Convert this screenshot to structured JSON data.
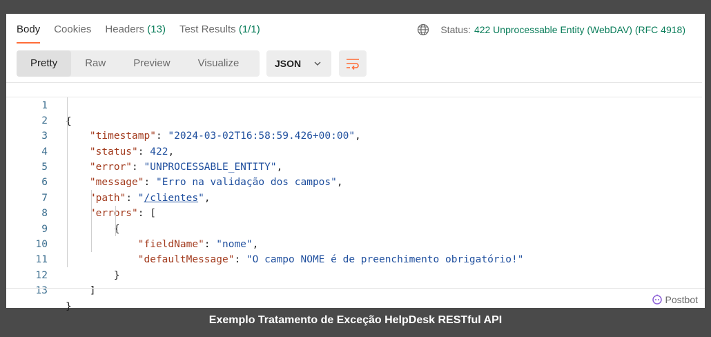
{
  "tabs": [
    {
      "label": "Body",
      "count": ""
    },
    {
      "label": "Cookies",
      "count": ""
    },
    {
      "label": "Headers",
      "count": "(13)"
    },
    {
      "label": "Test Results",
      "count": "(1/1)"
    }
  ],
  "status": {
    "label": "Status:",
    "value": "422 Unprocessable Entity (WebDAV) (RFC 4918)",
    "icon": "globe-icon"
  },
  "view_modes": [
    "Pretty",
    "Raw",
    "Preview",
    "Visualize"
  ],
  "format": {
    "selected": "JSON",
    "icon": "chevron-down-icon"
  },
  "wrap_icon": "wrap-lines-icon",
  "code_lines": [
    {
      "n": "1"
    },
    {
      "n": "2"
    },
    {
      "n": "3"
    },
    {
      "n": "4"
    },
    {
      "n": "5"
    },
    {
      "n": "6"
    },
    {
      "n": "7"
    },
    {
      "n": "8"
    },
    {
      "n": "9"
    },
    {
      "n": "10"
    },
    {
      "n": "11"
    },
    {
      "n": "12"
    },
    {
      "n": "13"
    }
  ],
  "json": {
    "timestamp_key": "\"timestamp\"",
    "timestamp_val": "\"2024-03-02T16:58:59.426+00:00\"",
    "status_key": "\"status\"",
    "status_val": "422",
    "error_key": "\"error\"",
    "error_val": "\"UNPROCESSABLE_ENTITY\"",
    "message_key": "\"message\"",
    "message_val": "\"Erro na validação dos campos\"",
    "path_key": "\"path\"",
    "path_val": "/clientes",
    "errors_key": "\"errors\"",
    "field_key": "\"fieldName\"",
    "field_val": "\"nome\"",
    "default_key": "\"defaultMessage\"",
    "default_val": "\"O campo NOME é de preenchimento obrigatório!\""
  },
  "postbot": {
    "label": "Postbot",
    "icon": "postbot-icon"
  },
  "caption": "Exemplo Tratamento de Exceção HelpDesk RESTful API"
}
